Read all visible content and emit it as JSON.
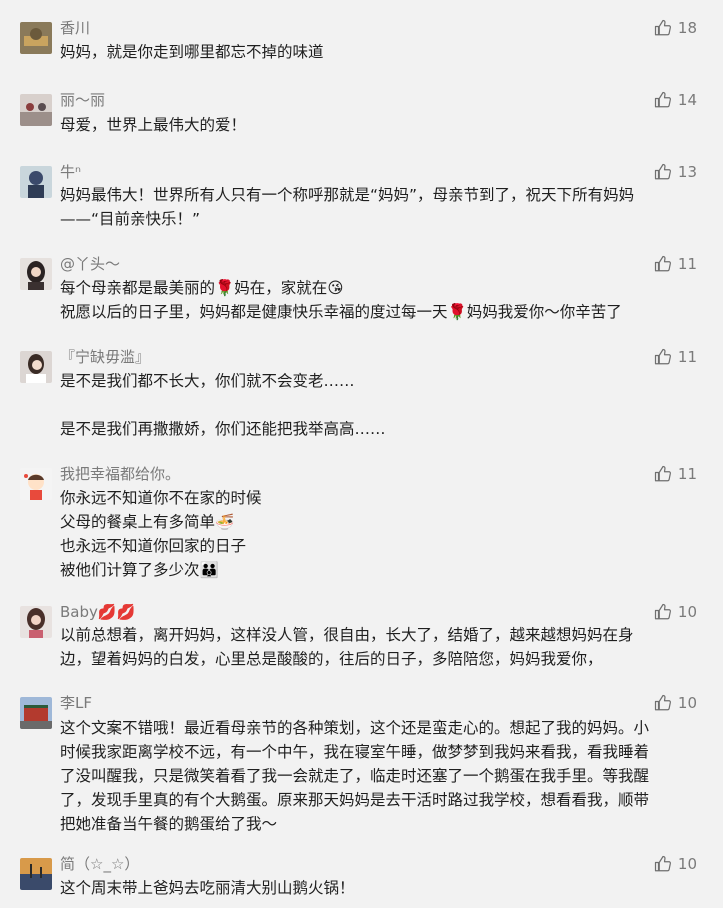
{
  "comments": [
    {
      "author": "香川",
      "likes": "18",
      "text": "妈妈，就是你走到哪里都忘不掉的味道"
    },
    {
      "author": "丽～丽",
      "likes": "14",
      "text": "母爱，世界上最伟大的爱！"
    },
    {
      "author": "牛ⁿ",
      "likes": "13",
      "text": "妈妈最伟大！世界所有人只有一个称呼那就是“妈妈”，母亲节到了，祝天下所有妈妈\n——“目前亲快乐！”"
    },
    {
      "author": "@丫头～",
      "likes": "11",
      "text": "每个母亲都是最美丽的🌹妈在，家就在😘\n祝愿以后的日子里，妈妈都是健康快乐幸福的度过每一天🌹妈妈我爱你～你辛苦了"
    },
    {
      "author": "『宁缺毋滥』",
      "likes": "11",
      "text": "是不是我们都不长大，你们就不会变老……\n\n是不是我们再撒撒娇，你们还能把我举高高……"
    },
    {
      "author": "我把幸福都给你。",
      "likes": "11",
      "text": "你永远不知道你不在家的时候\n父母的餐桌上有多简单🍜\n也永远不知道你回家的日子\n被他们计算了多少次👪"
    },
    {
      "author": "Baby💋💋",
      "likes": "10",
      "text": "以前总想着，离开妈妈，这样没人管，很自由，长大了，结婚了，越来越想妈妈在身\n边，望着妈妈的白发，心里总是酸酸的，往后的日子，多陪陪您，妈妈我爱你，"
    },
    {
      "author": "李LF",
      "likes": "10",
      "text": "这个文案不错哦！最近看母亲节的各种策划，这个还是蛮走心的。想起了我的妈妈。小\n时候我家距离学校不远，有一个中午，我在寝室午睡，做梦梦到我妈来看我，看我睡着\n了没叫醒我，只是微笑着看了我一会就走了，临走时还塞了一个鹅蛋在我手里。等我醒\n了，发现手里真的有个大鹅蛋。原来那天妈妈是去干活时路过我学校，想看看我，顺带\n把她准备当午餐的鹅蛋给了我～"
    },
    {
      "author": "简（☆_☆）",
      "likes": "10",
      "text": "这个周末带上爸妈去吃丽清大别山鹅火锅！"
    }
  ]
}
